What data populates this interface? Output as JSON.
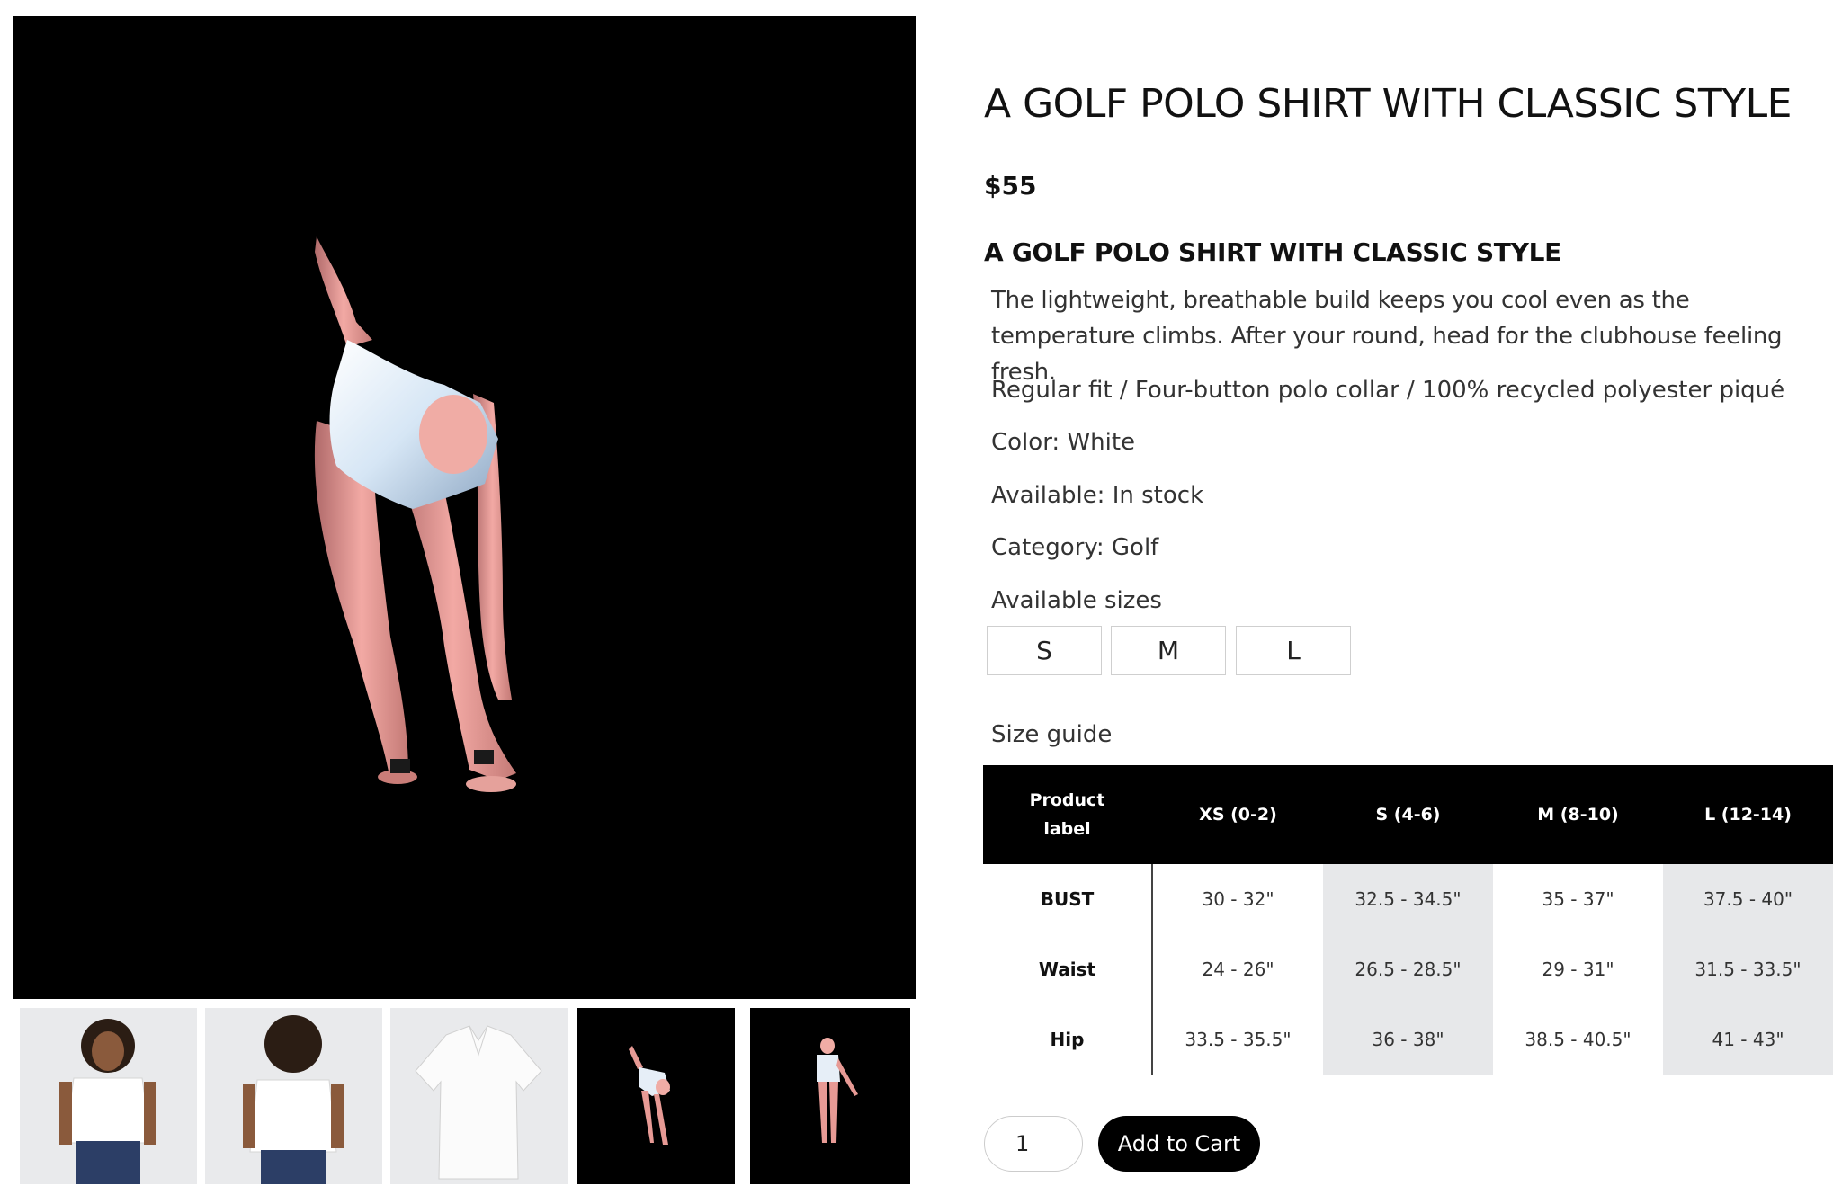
{
  "product": {
    "title": "A GOLF POLO SHIRT WITH CLASSIC STYLE",
    "price": "$55",
    "subtitle": "A GOLF POLO SHIRT WITH CLASSIC STYLE",
    "description": "The lightweight, breathable build keeps you cool even as the temperature climbs. After your round, head for the clubhouse feeling fresh.",
    "features": "Regular fit / Four-button polo collar / 100% recycled polyester piqué",
    "color_line": "Color: White",
    "availability_line": "Available: In stock",
    "category_line": "Category: Golf",
    "sizes_label": "Available sizes",
    "sizes": [
      "S",
      "M",
      "L"
    ]
  },
  "size_guide": {
    "label": "Size guide",
    "header_label_line1": "Product",
    "header_label_line2": "label",
    "columns": [
      "XS (0-2)",
      "S (4-6)",
      "M (8-10)",
      "L (12-14)"
    ],
    "rows": [
      {
        "label": "BUST",
        "values": [
          "30 - 32\"",
          "32.5 - 34.5\"",
          "35 - 37\"",
          "37.5 - 40\""
        ]
      },
      {
        "label": "Waist",
        "values": [
          "24 - 26\"",
          "26.5 - 28.5\"",
          "29 - 31\"",
          "31.5 - 33.5\""
        ]
      },
      {
        "label": "Hip",
        "values": [
          "33.5 - 35.5\"",
          "36 - 38\"",
          "38.5 - 40.5\"",
          "41 - 43\""
        ]
      }
    ]
  },
  "cart": {
    "quantity": "1",
    "add_label": "Add to Cart"
  },
  "gallery": {
    "thumbnails": [
      "model-front",
      "model-back",
      "shirt-flat",
      "3d-avatar-bending",
      "3d-avatar-standing"
    ]
  },
  "colors": {
    "viewer_bg": "#000000",
    "thumb_bg": "#e9eaec",
    "table_header_bg": "#000000",
    "table_shade": "#e7e8ea",
    "button_bg": "#000000"
  }
}
